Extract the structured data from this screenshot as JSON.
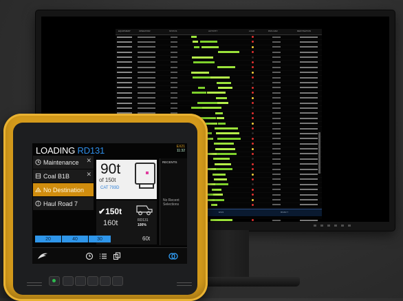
{
  "handheld": {
    "title_prefix": "LOADING",
    "title_id": "RD131",
    "clock_top": "EX21",
    "clock_bottom": "11:32",
    "menu": [
      {
        "label": "Maintenance",
        "icon": "clock-icon",
        "closable": true,
        "selected": false
      },
      {
        "label": "Coal B1B",
        "icon": "material-icon",
        "closable": true,
        "selected": false
      },
      {
        "label": "No Destination",
        "icon": "destination-icon",
        "closable": false,
        "selected": true
      },
      {
        "label": "Haul Road 7",
        "icon": "road-icon",
        "closable": false,
        "selected": false
      }
    ],
    "current_load": {
      "value": "90t",
      "of": "of 150t",
      "truck": "CAT 793D"
    },
    "target": {
      "value": "150t",
      "actual": "160t",
      "truck_id": "RD131",
      "percent": "100%"
    },
    "recents": {
      "header": "RECENTS",
      "empty": "No Recent Selections"
    },
    "pass_segments": [
      "20",
      "40",
      "30"
    ],
    "pass_total": "60t",
    "close_glyph": "✕",
    "accent": "#2f96ea",
    "selected_color": "#d08d0e"
  },
  "monitor": {
    "headers": [
      "EQUIPMENT",
      "OPERATOR",
      "STATUS",
      "ACTIVITY",
      "LOAD",
      "PAYLOAD",
      "DESTINATION"
    ],
    "footer": [
      "RD131",
      "EX21",
      "ROAD 7"
    ]
  }
}
